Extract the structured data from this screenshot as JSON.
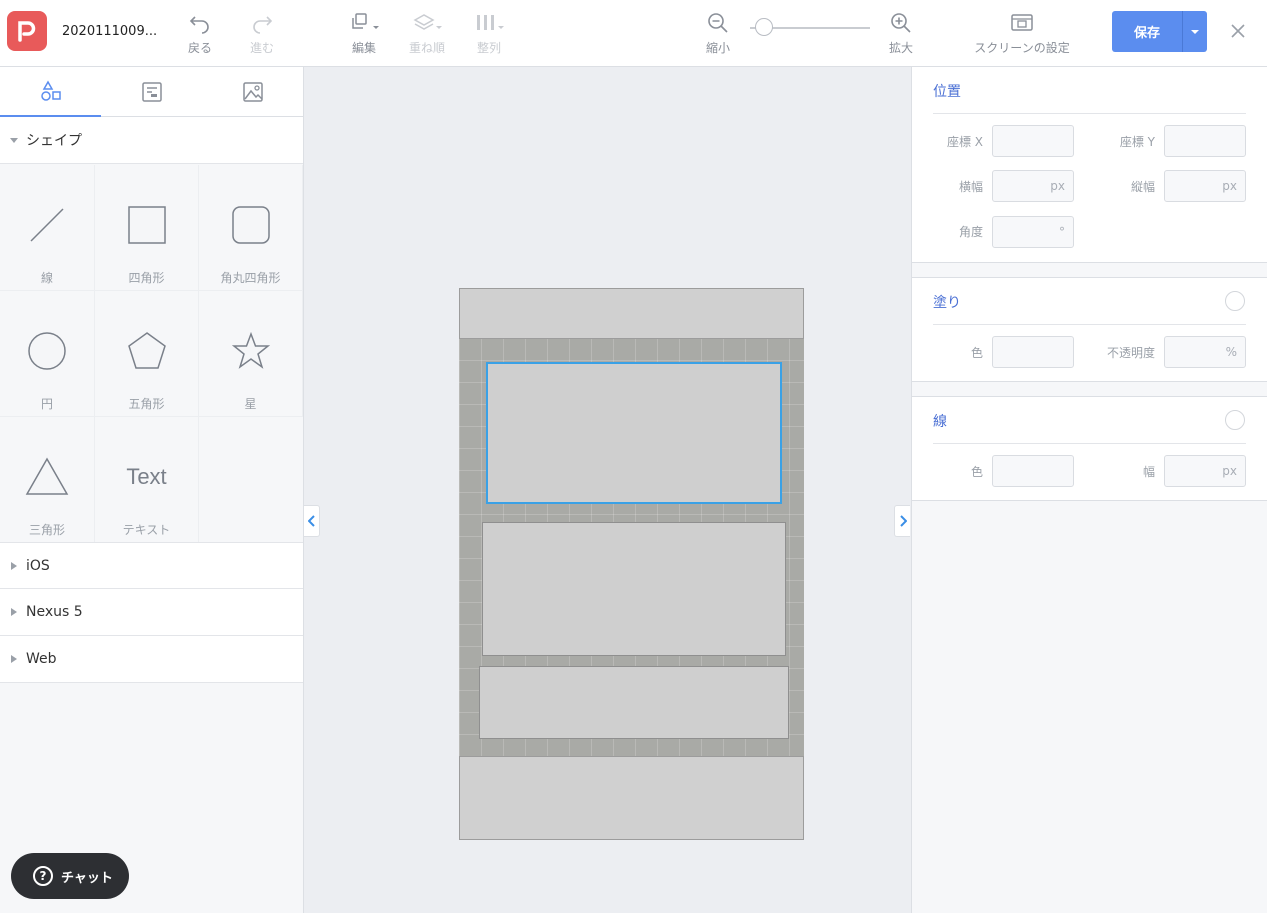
{
  "app": {
    "filename": "2020111009...",
    "brand_color": "#e85a5a",
    "accent_color": "#5b8def"
  },
  "toolbar": {
    "undo": "戻る",
    "redo": "進む",
    "edit": "編集",
    "order": "重ね順",
    "align": "整列",
    "zoom_out": "縮小",
    "zoom_in": "拡大",
    "zoom_level": 0.12,
    "screen_settings": "スクリーンの設定",
    "save": "保存"
  },
  "left": {
    "tabs": [
      "shapes-icon",
      "components-icon",
      "image-icon"
    ],
    "shapes_section": "シェイプ",
    "shapes": [
      {
        "name": "line",
        "label": "線"
      },
      {
        "name": "rect",
        "label": "四角形"
      },
      {
        "name": "rounded-rect",
        "label": "角丸四角形"
      },
      {
        "name": "circle",
        "label": "円"
      },
      {
        "name": "pentagon",
        "label": "五角形"
      },
      {
        "name": "star",
        "label": "星"
      },
      {
        "name": "triangle",
        "label": "三角形"
      },
      {
        "name": "text",
        "label": "テキスト",
        "glyph": "Text"
      }
    ],
    "sections": [
      "iOS",
      "Nexus 5",
      "Web"
    ],
    "chat": "チャット"
  },
  "right": {
    "position": {
      "title": "位置",
      "x_label": "座標 X",
      "y_label": "座標 Y",
      "width_label": "横幅",
      "height_label": "縦幅",
      "angle_label": "角度",
      "unit_px": "px",
      "unit_deg": "°"
    },
    "fill": {
      "title": "塗り",
      "color_label": "色",
      "opacity_label": "不透明度",
      "unit_pct": "%"
    },
    "stroke": {
      "title": "線",
      "color_label": "色",
      "width_label": "幅",
      "unit_px": "px"
    }
  }
}
